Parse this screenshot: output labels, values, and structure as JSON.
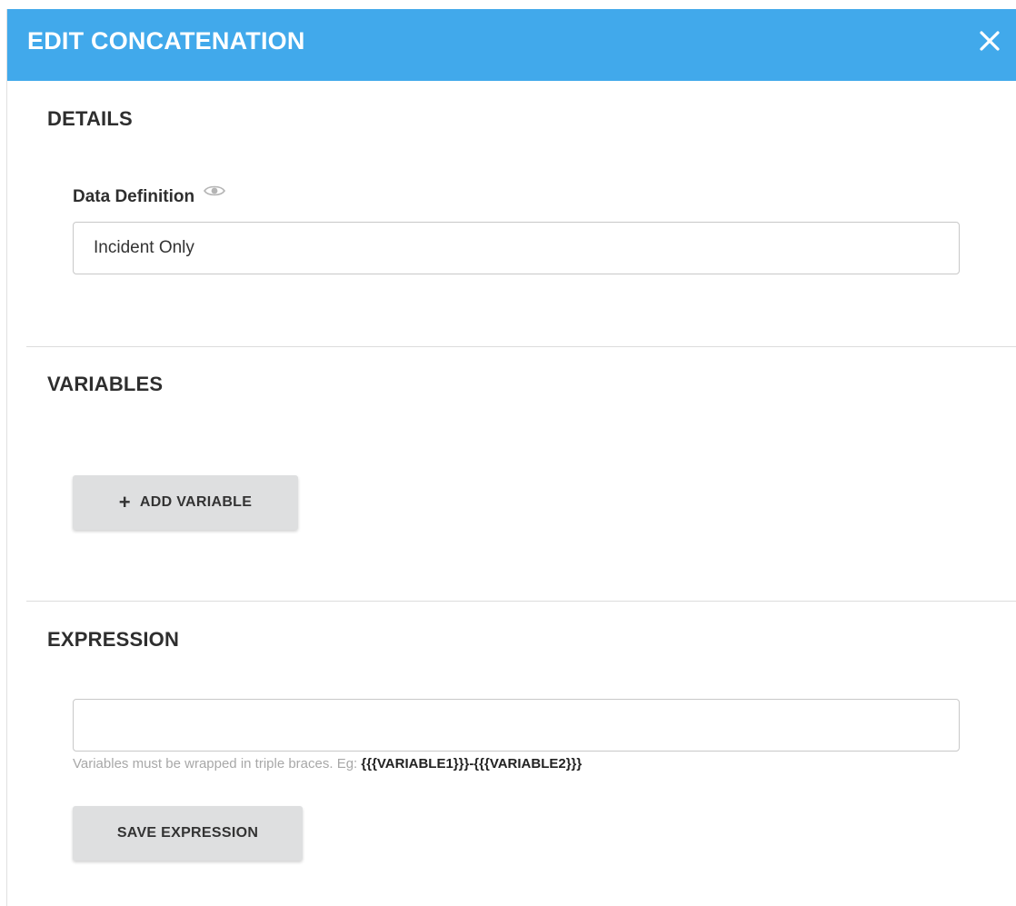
{
  "dialog": {
    "title": "EDIT CONCATENATION",
    "close_icon": "close-icon",
    "header_color": "#41a9eb"
  },
  "details": {
    "section_title": "DETAILS",
    "field_label": "Data Definition",
    "field_icon": "eye-icon",
    "field_value": "Incident Only"
  },
  "variables": {
    "section_title": "VARIABLES",
    "add_button_icon": "plus-icon",
    "add_button_label": "ADD VARIABLE"
  },
  "expression": {
    "section_title": "EXPRESSION",
    "input_value": "",
    "hint_text": "Variables must be wrapped in triple braces. Eg: ",
    "hint_example": "{{{VARIABLE1}}}-{{{VARIABLE2}}}",
    "save_button_label": "SAVE EXPRESSION"
  }
}
